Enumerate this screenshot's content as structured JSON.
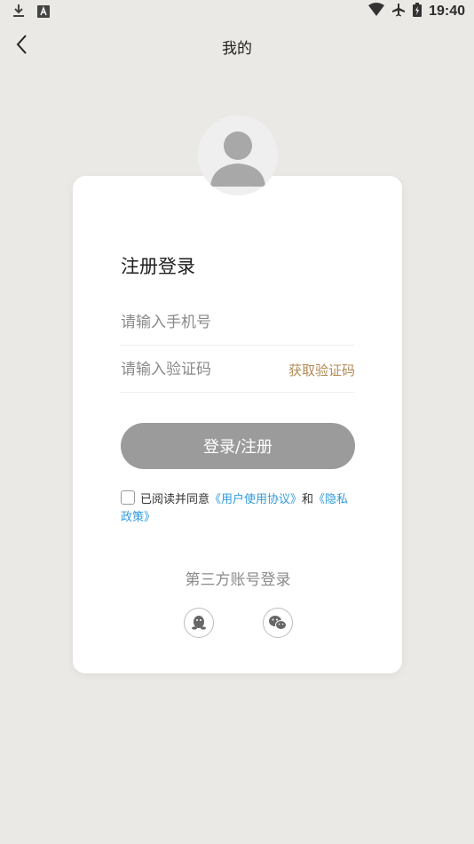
{
  "status_bar": {
    "time": "19:40"
  },
  "header": {
    "title": "我的"
  },
  "login": {
    "title": "注册登录",
    "phone_placeholder": "请输入手机号",
    "code_placeholder": "请输入验证码",
    "get_code_label": "获取验证码",
    "submit_label": "登录/注册",
    "agreement_prefix": "已阅读并同意",
    "user_agreement": "《用户使用协议》",
    "and": "和",
    "privacy_policy": "《隐私政策》",
    "agreed": false
  },
  "third_party": {
    "title": "第三方账号登录",
    "providers": [
      "qq-icon",
      "wechat-icon"
    ]
  },
  "colors": {
    "background": "#ebe9e5",
    "accent_gold": "#b38b54",
    "link_blue": "#2f9ae0",
    "button_gray": "#9b9b9b"
  }
}
